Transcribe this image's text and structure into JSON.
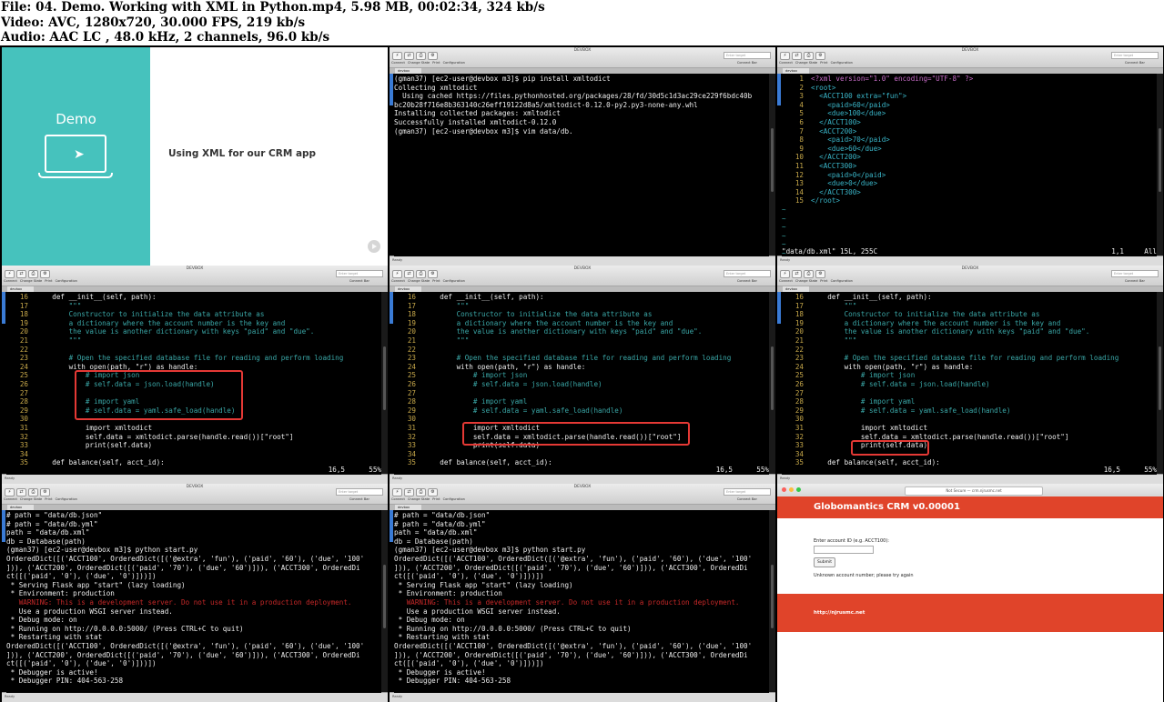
{
  "header": {
    "file_line": "File: 04. Demo. Working with XML in Python.mp4, 5.98 MB, 00:02:34, 324 kb/s",
    "video_line": "Video: AVC, 1280x720, 30.000 FPS, 219 kb/s",
    "audio_line": "Audio: AAC LC , 48.0 kHz, 2 channels, 96.0 kb/s"
  },
  "slide": {
    "demo_label": "Demo",
    "title": "Using XML for our CRM app"
  },
  "term_window": {
    "title": "DEVBOX",
    "tab": "devbox",
    "toolbar_labels": [
      "Connect",
      "Change State",
      "Print",
      "Configuration"
    ],
    "find_placeholder": "Enter target",
    "connect_bar": "Connect Bar",
    "status_ready": "Ready"
  },
  "frame2": {
    "lines": [
      "(gman37) [ec2-user@devbox m3]$ pip install xmltodict",
      "Collecting xmltodict",
      "  Using cached https://files.pythonhosted.org/packages/28/fd/30d5c1d3ac29ce229f6bdc40b",
      "bc20b28f716e8b363140c26eff19122d8a5/xmltodict-0.12.0-py2.py3-none-any.whl",
      "Installing collected packages: xmltodict",
      "Successfully installed xmltodict-0.12.0",
      "(gman37) [ec2-user@devbox m3]$ vim data/db."
    ]
  },
  "frame3": {
    "lines": [
      {
        "n": "1",
        "pre": "",
        "t": "<?xml version=\"1.0\" encoding=\"UTF-8\" ?>",
        "c": "pi"
      },
      {
        "n": "2",
        "pre": "",
        "t": "<root>",
        "c": "tag"
      },
      {
        "n": "3",
        "pre": "  ",
        "t": "<ACCT100 extra=\"fun\">",
        "c": "tag"
      },
      {
        "n": "4",
        "pre": "    ",
        "t": "<paid>60</paid>",
        "c": "tag"
      },
      {
        "n": "5",
        "pre": "    ",
        "t": "<due>100</due>",
        "c": "tag"
      },
      {
        "n": "6",
        "pre": "  ",
        "t": "</ACCT100>",
        "c": "tag"
      },
      {
        "n": "7",
        "pre": "  ",
        "t": "<ACCT200>",
        "c": "tag"
      },
      {
        "n": "8",
        "pre": "    ",
        "t": "<paid>70</paid>",
        "c": "tag"
      },
      {
        "n": "9",
        "pre": "    ",
        "t": "<due>60</due>",
        "c": "tag"
      },
      {
        "n": "10",
        "pre": "  ",
        "t": "</ACCT200>",
        "c": "tag"
      },
      {
        "n": "11",
        "pre": "  ",
        "t": "<ACCT300>",
        "c": "tag"
      },
      {
        "n": "12",
        "pre": "    ",
        "t": "<paid>0</paid>",
        "c": "tag"
      },
      {
        "n": "13",
        "pre": "    ",
        "t": "<due>0</due>",
        "c": "tag"
      },
      {
        "n": "14",
        "pre": "  ",
        "t": "</ACCT300>",
        "c": "tag"
      },
      {
        "n": "15",
        "pre": "",
        "t": "</root>",
        "c": "tag"
      }
    ],
    "tilde_count": 6,
    "status_left": "\"data/db.xml\" 15L, 255C",
    "status_pos": "1,1",
    "status_right": "All"
  },
  "code": {
    "lines": [
      {
        "n": "16",
        "t": "    def __init__(self, path):",
        "c": ""
      },
      {
        "n": "17",
        "t": "        \"\"\"",
        "c": "dq"
      },
      {
        "n": "18",
        "t": "        Constructor to initialize the data attribute as",
        "c": "dq"
      },
      {
        "n": "19",
        "t": "        a dictionary where the account number is the key and",
        "c": "dq"
      },
      {
        "n": "20",
        "t": "        the value is another dictionary with keys \"paid\" and \"due\".",
        "c": "dq"
      },
      {
        "n": "21",
        "t": "        \"\"\"",
        "c": "dq"
      },
      {
        "n": "22",
        "t": "",
        "c": ""
      },
      {
        "n": "23",
        "t": "        # Open the specified database file for reading and perform loading",
        "c": "cm"
      },
      {
        "n": "24",
        "t": "        with open(path, \"r\") as handle:",
        "c": ""
      },
      {
        "n": "25",
        "t": "            # import json",
        "c": "cm"
      },
      {
        "n": "26",
        "t": "            # self.data = json.load(handle)",
        "c": "cm"
      },
      {
        "n": "27",
        "t": "",
        "c": ""
      },
      {
        "n": "28",
        "t": "            # import yaml",
        "c": "cm"
      },
      {
        "n": "29",
        "t": "            # self.data = yaml.safe_load(handle)",
        "c": "cm"
      },
      {
        "n": "30",
        "t": "",
        "c": ""
      },
      {
        "n": "31",
        "t": "            import xmltodict",
        "c": ""
      },
      {
        "n": "32",
        "t": "            self.data = xmltodict.parse(handle.read())[\"root\"]",
        "c": ""
      },
      {
        "n": "33",
        "t": "            print(self.data)",
        "c": ""
      },
      {
        "n": "34",
        "t": "",
        "c": ""
      },
      {
        "n": "35",
        "t": "    def balance(self, acct_id):",
        "c": ""
      }
    ],
    "status_pos": "16,5",
    "status_pct": "55%"
  },
  "run": {
    "lines": [
      {
        "t": "# path = \"data/db.json\"",
        "c": ""
      },
      {
        "t": "# path = \"data/db.yml\"",
        "c": ""
      },
      {
        "t": "path = \"data/db.xml\"",
        "c": ""
      },
      {
        "t": "db = Database(path)",
        "c": ""
      },
      {
        "t": "(gman37) [ec2-user@devbox m3]$ python start.py",
        "c": ""
      },
      {
        "t": "OrderedDict([('ACCT100', OrderedDict([('@extra', 'fun'), ('paid', '60'), ('due', '100'",
        "c": ""
      },
      {
        "t": "])), ('ACCT200', OrderedDict([('paid', '70'), ('due', '60')])), ('ACCT300', OrderedDi",
        "c": ""
      },
      {
        "t": "ct([('paid', '0'), ('due', '0')]))])",
        "c": ""
      },
      {
        "t": " * Serving Flask app \"start\" (lazy loading)",
        "c": ""
      },
      {
        "t": " * Environment: production",
        "c": ""
      },
      {
        "t": "   WARNING: This is a development server. Do not use it in a production deployment.",
        "c": "warn"
      },
      {
        "t": "   Use a production WSGI server instead.",
        "c": ""
      },
      {
        "t": " * Debug mode: on",
        "c": ""
      },
      {
        "t": " * Running on http://0.0.0.0:5000/ (Press CTRL+C to quit)",
        "c": ""
      },
      {
        "t": " * Restarting with stat",
        "c": ""
      },
      {
        "t": "OrderedDict([('ACCT100', OrderedDict([('@extra', 'fun'), ('paid', '60'), ('due', '100'",
        "c": ""
      },
      {
        "t": "])), ('ACCT200', OrderedDict([('paid', '70'), ('due', '60')])), ('ACCT300', OrderedDi",
        "c": ""
      },
      {
        "t": "ct([('paid', '0'), ('due', '0')]))])",
        "c": ""
      },
      {
        "t": " * Debugger is active!",
        "c": ""
      },
      {
        "t": " * Debugger PIN: 404-563-258",
        "c": ""
      }
    ]
  },
  "browser": {
    "url": "Not Secure — crm.njrusmc.net",
    "header": "Globomantics CRM v0.00001",
    "label": "Enter account ID (e.g. ACCT100):",
    "submit": "Submit",
    "message": "Unknown account number; please try again",
    "footer": "http://njrusmc.net",
    "colors": {
      "brand_red": "#e0442a"
    }
  }
}
